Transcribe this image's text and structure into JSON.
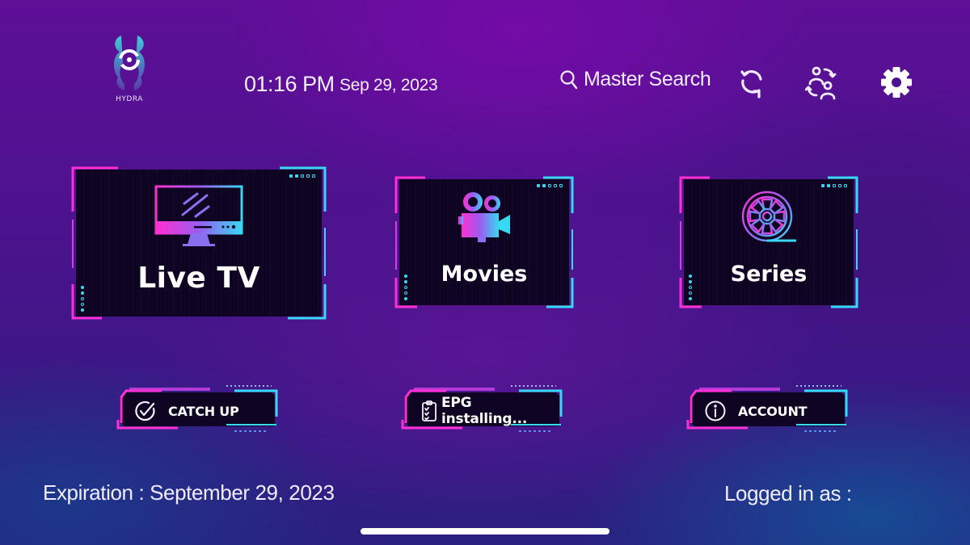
{
  "app": {
    "logo_text": "HYDRA"
  },
  "header": {
    "time": "01:16 PM",
    "date": "Sep 29, 2023",
    "search_label": "Master Search",
    "icons": [
      "search-icon",
      "refresh-icon",
      "switch-user-icon",
      "settings-gear-icon"
    ]
  },
  "tiles": [
    {
      "label": "Live TV",
      "icon": "tv-monitor-icon"
    },
    {
      "label": "Movies",
      "icon": "movie-camera-icon"
    },
    {
      "label": "Series",
      "icon": "film-reel-icon"
    }
  ],
  "buttons": [
    {
      "label": "CATCH UP",
      "icon": "check-circle-icon"
    },
    {
      "label": "EPG installing...",
      "icon": "clipboard-checklist-icon"
    },
    {
      "label": "ACCOUNT",
      "icon": "info-circle-icon"
    }
  ],
  "footer": {
    "expiration": "Expiration : September 29, 2023",
    "logged_in": "Logged in as :"
  },
  "colors": {
    "accent_pink": "#ff2fd0",
    "accent_cyan": "#36d8f2",
    "tile_bg": "#0f0522",
    "text": "#ffffff"
  }
}
